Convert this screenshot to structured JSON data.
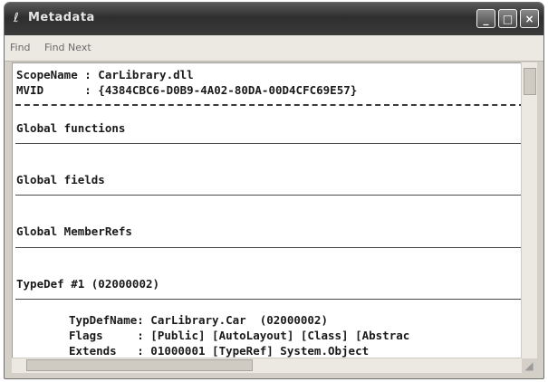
{
  "window": {
    "title": "Metadata",
    "controls": [
      "_",
      "□",
      "×"
    ]
  },
  "menu": [
    "Find",
    "Find Next"
  ],
  "lines": {
    "scope": "ScopeName : CarLibrary.dll",
    "mvid": "MVID      : {4384CBC6-D0B9-4A02-80DA-00D4CFC69E57}",
    "global_functions": "Global functions",
    "global_fields": "Global fields",
    "global_memberrefs": "Global MemberRefs",
    "typedef": "TypeDef #1 (02000002)",
    "typedef_name": "TypDefName: CarLibrary.Car  (02000002)",
    "flags": "Flags     : [Public] [AutoLayout] [Class] [Abstrac",
    "extends": "Extends   : 01000001 [TypeRef] System.Object"
  }
}
